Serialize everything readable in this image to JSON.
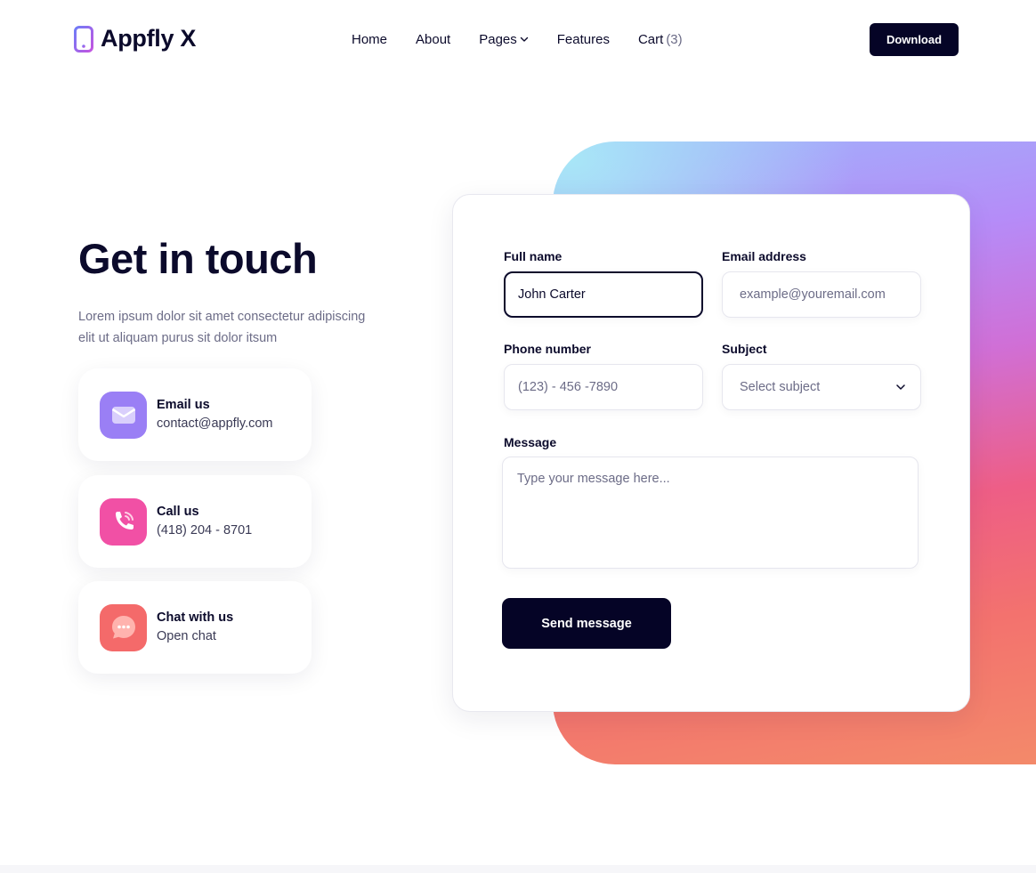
{
  "brand": {
    "name": "Appfly X",
    "color": "#8b5cf6"
  },
  "nav": {
    "home": "Home",
    "about": "About",
    "pages": "Pages",
    "features": "Features",
    "cart": "Cart",
    "cart_count": "(3)"
  },
  "download_label": "Download",
  "hero": {
    "title": "Get in touch",
    "description": "Lorem ipsum dolor sit amet consectetur adipiscing elit ut aliquam purus sit dolor itsum"
  },
  "contacts": [
    {
      "title": "Email us",
      "value": "contact@appfly.com",
      "icon": "envelope-icon",
      "color": "#9a7ff5"
    },
    {
      "title": "Call us",
      "value": "(418) 204 - 8701",
      "icon": "phone-icon",
      "color": "#f150a5"
    },
    {
      "title": "Chat with us",
      "value": "Open chat",
      "icon": "chat-bubble-icon",
      "color": "#f46a6a"
    }
  ],
  "form": {
    "full_name_label": "Full name",
    "full_name_value": "John Carter",
    "email_label": "Email address",
    "email_placeholder": "example@youremail.com",
    "phone_label": "Phone number",
    "phone_placeholder": "(123) - 456 -7890",
    "subject_label": "Subject",
    "subject_selected": "Select subject",
    "message_label": "Message",
    "message_placeholder": "Type your message here...",
    "submit_label": "Send message"
  }
}
